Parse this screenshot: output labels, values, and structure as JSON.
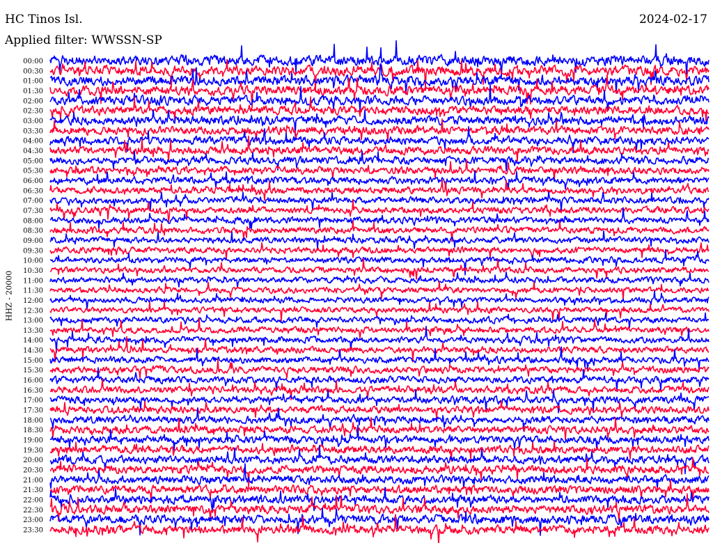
{
  "header": {
    "station": "HC Tinos Isl.",
    "date": "2024-02-17",
    "filter": "Applied filter: WWSSN-SP"
  },
  "chart_data": {
    "type": "line",
    "title": "HC Tinos Isl.",
    "ylabel": "HHZ - 20000",
    "rows": [
      "00:00",
      "00:30",
      "01:00",
      "01:30",
      "02:00",
      "02:30",
      "03:00",
      "03:30",
      "04:00",
      "04:30",
      "05:00",
      "05:30",
      "06:00",
      "06:30",
      "07:00",
      "07:30",
      "08:00",
      "08:30",
      "09:00",
      "09:30",
      "10:00",
      "10:30",
      "11:00",
      "11:30",
      "12:00",
      "12:30",
      "13:00",
      "13:30",
      "14:00",
      "14:30",
      "15:00",
      "15:30",
      "16:00",
      "16:30",
      "17:00",
      "17:30",
      "18:00",
      "18:30",
      "19:00",
      "19:30",
      "20:00",
      "20:30",
      "21:00",
      "21:30",
      "22:00",
      "22:30",
      "23:00",
      "23:30"
    ],
    "row_duration_minutes": 30,
    "trace_colors": [
      "#0000ff",
      "#ff0033"
    ],
    "grid": false
  }
}
